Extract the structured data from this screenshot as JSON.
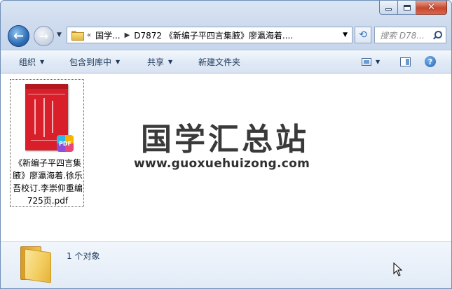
{
  "window": {
    "caption_buttons": [
      "minimize",
      "maximize",
      "close"
    ]
  },
  "address": {
    "overflow": "«",
    "crumbs": [
      "国学...",
      "D7872 《新编子平四言集腋》廖瀛海着...."
    ]
  },
  "search": {
    "placeholder": "搜索 D78..."
  },
  "toolbar": {
    "organize_label": "组织",
    "include_label": "包含到库中",
    "share_label": "共享",
    "new_folder_label": "新建文件夹"
  },
  "file": {
    "name": "《新编子平四言集腋》廖瀛海着.徐乐吾校订.李崇仰重编725页.pdf",
    "badge": "PDF"
  },
  "watermark": {
    "title": "国学汇总站",
    "url": "www.guoxuehuizong.com"
  },
  "status": {
    "count_text": "1 个对象"
  },
  "colors": {
    "cover_red": "#d9202a",
    "chrome_blue": "#dbe6f4",
    "text_blue": "#1e395b"
  }
}
